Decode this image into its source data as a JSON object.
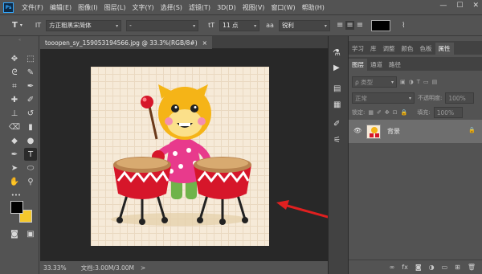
{
  "app": {
    "logo": "Ps"
  },
  "menu": [
    "文件(F)",
    "编辑(E)",
    "图像(I)",
    "图层(L)",
    "文字(Y)",
    "选择(S)",
    "滤镜(T)",
    "3D(D)",
    "视图(V)",
    "窗口(W)",
    "帮助(H)"
  ],
  "window_controls": {
    "minimize": "—",
    "maximize": "☐",
    "close": "✕"
  },
  "options_bar": {
    "tool_glyph": "T",
    "orient_glyph": "IT",
    "font_family": "方正粗黑宋简体",
    "font_style": "-",
    "size_glyph": "tT",
    "font_size": "11 点",
    "aa_glyph": "aa",
    "anti_alias": "锐利",
    "color_swatch": "#000000"
  },
  "document": {
    "tab_title": "tooopen_sy_159053194566.jpg @ 33.3%(RGB/8#)",
    "tab_close": "×",
    "zoom": "33.33%",
    "doc_info": "文档:3.00M/3.00M",
    "status_caret": ">"
  },
  "tools": [
    {
      "name": "move-tool",
      "glyph": "✥"
    },
    {
      "name": "marquee-tool",
      "glyph": "⬚"
    },
    {
      "name": "lasso-tool",
      "glyph": "ᘓ"
    },
    {
      "name": "quick-select-tool",
      "glyph": "✎"
    },
    {
      "name": "crop-tool",
      "glyph": "⌗"
    },
    {
      "name": "eyedropper-tool",
      "glyph": "✒"
    },
    {
      "name": "healing-tool",
      "glyph": "✚"
    },
    {
      "name": "brush-tool",
      "glyph": "✐"
    },
    {
      "name": "stamp-tool",
      "glyph": "⊥"
    },
    {
      "name": "history-brush-tool",
      "glyph": "↺"
    },
    {
      "name": "eraser-tool",
      "glyph": "⌫"
    },
    {
      "name": "gradient-tool",
      "glyph": "▮"
    },
    {
      "name": "blur-tool",
      "glyph": "◆"
    },
    {
      "name": "dodge-tool",
      "glyph": "●"
    },
    {
      "name": "pen-tool",
      "glyph": "✒"
    },
    {
      "name": "type-tool",
      "glyph": "T"
    },
    {
      "name": "path-select-tool",
      "glyph": "➤"
    },
    {
      "name": "shape-tool",
      "glyph": "⬭"
    },
    {
      "name": "hand-tool",
      "glyph": "✋"
    },
    {
      "name": "zoom-tool",
      "glyph": "⚲"
    },
    {
      "name": "more-tools",
      "glyph": "•••"
    },
    {
      "name": "quick-mask",
      "glyph": "◙"
    },
    {
      "name": "screen-mode",
      "glyph": "▣"
    }
  ],
  "colors": {
    "foreground": "#000000",
    "background": "#f4c82c",
    "accent": "#31a8ff",
    "arrow": "#e02020"
  },
  "panels": {
    "top_tabs": [
      "学习",
      "库",
      "调整",
      "颜色",
      "色板",
      "属性"
    ],
    "active_top_tab": "属性",
    "layer_tabs": [
      "图层",
      "通道",
      "路径"
    ],
    "active_layer_tab": "图层",
    "kind_label": "ρ 类型",
    "blend_mode": "正常",
    "opacity_label": "不透明度:",
    "opacity_value": "100%",
    "lock_label": "锁定:",
    "fill_label": "填充:",
    "fill_value": "100%",
    "layer_name": "背景",
    "eye_glyph": "👁",
    "lock_glyph": "🔒",
    "footer_icons": [
      "∞",
      "fx",
      "◙",
      "◑",
      "▭",
      "⊞",
      "🗑"
    ],
    "collapse_glyph": "«"
  }
}
